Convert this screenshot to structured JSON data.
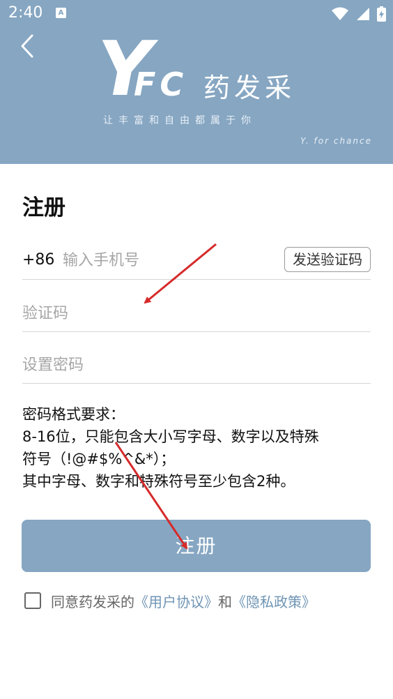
{
  "status_bar": {
    "time": "2:40",
    "a_icon": "A"
  },
  "header": {
    "logo_y": "Y",
    "logo_fc": "FC",
    "logo_cn": "药发采",
    "slogan": "让丰富和自由都属于你",
    "tagline": "Y. for chance"
  },
  "form": {
    "title": "注册",
    "phone_prefix": "+86",
    "phone_placeholder": "输入手机号",
    "send_code_label": "发送验证码",
    "code_placeholder": "验证码",
    "password_placeholder": "设置密码"
  },
  "rules": {
    "line1": "密码格式要求：",
    "line2": "8-16位，只能包含大小写字母、数字以及特殊",
    "line3": "符号（!@#$%^&*）；",
    "line4": "其中字母、数字和特殊符号至少包含2种。"
  },
  "register_label": "注册",
  "agreement": {
    "prefix": "同意药发采的",
    "user_agreement": "《用户协议》",
    "and": "和",
    "privacy_policy": "《隐私政策》"
  },
  "colors": {
    "header_bg": "#86a6c2",
    "link": "#6f94b4",
    "annotation_arrow": "#d62a2a"
  },
  "icons": [
    "back-arrow-icon",
    "wifi-icon",
    "signal-icon",
    "battery-icon",
    "checkbox-icon"
  ]
}
